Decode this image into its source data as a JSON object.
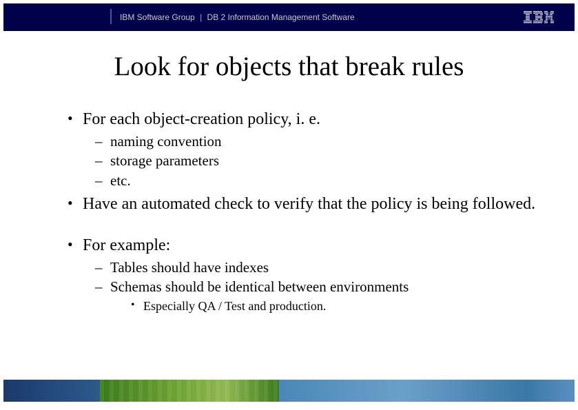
{
  "header": {
    "group": "IBM Software Group",
    "separator": "|",
    "product": "DB 2 Information Management Software",
    "logo_name": "IBM"
  },
  "title": "Look for objects that break rules",
  "bullets": {
    "b1": "For each object-creation policy, i. e.",
    "b1_sub": {
      "s1": "naming convention",
      "s2": "storage parameters",
      "s3": "etc."
    },
    "b2": "Have an automated check to verify that the policy is being followed.",
    "b3": "For example:",
    "b3_sub": {
      "s1": "Tables should have indexes",
      "s2": "Schemas should be identical between environments",
      "s2_sub": {
        "t1": "Especially QA / Test and production."
      }
    }
  }
}
